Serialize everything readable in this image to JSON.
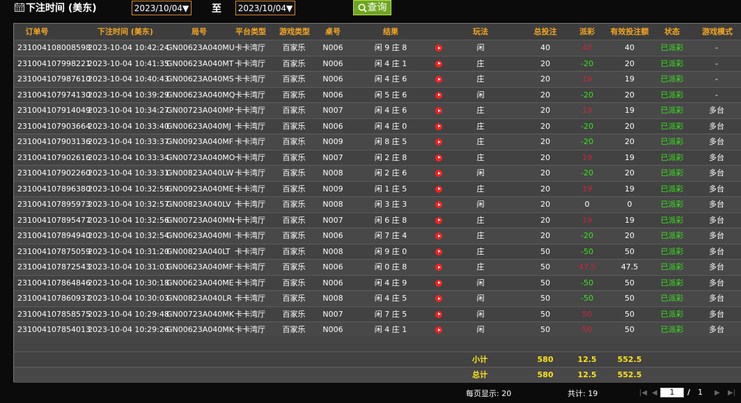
{
  "header": {
    "title": "下注时间 (美东)",
    "start_date": "2023/10/04▼",
    "to_label": "至",
    "end_date": "2023/10/04▼",
    "query_label": "查询"
  },
  "table": {
    "columns": [
      "订单号",
      "下注时间 (美东)",
      "局号",
      "平台类型",
      "游戏类型",
      "桌号",
      "结果",
      "玩法",
      "总投注",
      "派彩",
      "有效投注额",
      "状态",
      "游戏模式"
    ],
    "rows": [
      {
        "order": "231004108008598",
        "time": "2023-10-04 10:42:24",
        "round": "GN00623A040MU",
        "platform": "卡卡湾厅",
        "game": "百家乐",
        "table": "N006",
        "result": "闲 9 庄 8",
        "play": "闲",
        "bet": "40",
        "payout": "40",
        "payout_color": "red",
        "valid": "40",
        "status": "已派彩",
        "mode": "-"
      },
      {
        "order": "231004107998221",
        "time": "2023-10-04 10:41:35",
        "round": "GN00623A040MT",
        "platform": "卡卡湾厅",
        "game": "百家乐",
        "table": "N006",
        "result": "闲 4 庄 1",
        "play": "庄",
        "bet": "20",
        "payout": "-20",
        "payout_color": "green",
        "valid": "20",
        "status": "已派彩",
        "mode": "-"
      },
      {
        "order": "231004107987610",
        "time": "2023-10-04 10:40:43",
        "round": "GN00623A040MS",
        "platform": "卡卡湾厅",
        "game": "百家乐",
        "table": "N006",
        "result": "闲 4 庄 6",
        "play": "庄",
        "bet": "20",
        "payout": "19",
        "payout_color": "red",
        "valid": "19",
        "status": "已派彩",
        "mode": "-"
      },
      {
        "order": "231004107974130",
        "time": "2023-10-04 10:39:29",
        "round": "GN00623A040MQ",
        "platform": "卡卡湾厅",
        "game": "百家乐",
        "table": "N006",
        "result": "闲 5 庄 6",
        "play": "闲",
        "bet": "20",
        "payout": "-20",
        "payout_color": "green",
        "valid": "20",
        "status": "已派彩",
        "mode": "-"
      },
      {
        "order": "231004107914049",
        "time": "2023-10-04 10:34:27",
        "round": "GN00723A040MP",
        "platform": "卡卡湾厅",
        "game": "百家乐",
        "table": "N007",
        "result": "闲 4 庄 6",
        "play": "庄",
        "bet": "20",
        "payout": "19",
        "payout_color": "red",
        "valid": "19",
        "status": "已派彩",
        "mode": "多台"
      },
      {
        "order": "231004107903664",
        "time": "2023-10-04 10:33:40",
        "round": "GN00623A040MJ",
        "platform": "卡卡湾厅",
        "game": "百家乐",
        "table": "N006",
        "result": "闲 4 庄 0",
        "play": "庄",
        "bet": "20",
        "payout": "-20",
        "payout_color": "green",
        "valid": "20",
        "status": "已派彩",
        "mode": "多台"
      },
      {
        "order": "231004107903136",
        "time": "2023-10-04 10:33:37",
        "round": "GN00923A040MF",
        "platform": "卡卡湾厅",
        "game": "百家乐",
        "table": "N009",
        "result": "闲 8 庄 5",
        "play": "庄",
        "bet": "20",
        "payout": "-20",
        "payout_color": "green",
        "valid": "20",
        "status": "已派彩",
        "mode": "多台"
      },
      {
        "order": "231004107902616",
        "time": "2023-10-04 10:33:34",
        "round": "GN00723A040MO",
        "platform": "卡卡湾厅",
        "game": "百家乐",
        "table": "N007",
        "result": "闲 2 庄 8",
        "play": "庄",
        "bet": "20",
        "payout": "19",
        "payout_color": "red",
        "valid": "19",
        "status": "已派彩",
        "mode": "多台"
      },
      {
        "order": "231004107902260",
        "time": "2023-10-04 10:33:31",
        "round": "GN00823A040LW",
        "platform": "卡卡湾厅",
        "game": "百家乐",
        "table": "N008",
        "result": "闲 2 庄 6",
        "play": "闲",
        "bet": "20",
        "payout": "-20",
        "payout_color": "green",
        "valid": "20",
        "status": "已派彩",
        "mode": "多台"
      },
      {
        "order": "231004107896380",
        "time": "2023-10-04 10:32:59",
        "round": "GN00923A040ME",
        "platform": "卡卡湾厅",
        "game": "百家乐",
        "table": "N009",
        "result": "闲 1 庄 5",
        "play": "庄",
        "bet": "20",
        "payout": "19",
        "payout_color": "red",
        "valid": "19",
        "status": "已派彩",
        "mode": "多台"
      },
      {
        "order": "231004107895973",
        "time": "2023-10-04 10:32:57",
        "round": "GN00823A040LV",
        "platform": "卡卡湾厅",
        "game": "百家乐",
        "table": "N008",
        "result": "闲 3 庄 3",
        "play": "闲",
        "bet": "20",
        "payout": "0",
        "payout_color": "white",
        "valid": "0",
        "status": "已派彩",
        "mode": "多台"
      },
      {
        "order": "231004107895477",
        "time": "2023-10-04 10:32:56",
        "round": "GN00723A040MN",
        "platform": "卡卡湾厅",
        "game": "百家乐",
        "table": "N007",
        "result": "闲 6 庄 8",
        "play": "庄",
        "bet": "20",
        "payout": "19",
        "payout_color": "red",
        "valid": "19",
        "status": "已派彩",
        "mode": "多台"
      },
      {
        "order": "231004107894940",
        "time": "2023-10-04 10:32:54",
        "round": "GN00623A040MI",
        "platform": "卡卡湾厅",
        "game": "百家乐",
        "table": "N006",
        "result": "闲 7 庄 4",
        "play": "庄",
        "bet": "20",
        "payout": "-20",
        "payout_color": "green",
        "valid": "20",
        "status": "已派彩",
        "mode": "多台"
      },
      {
        "order": "231004107875059",
        "time": "2023-10-04 10:31:20",
        "round": "GN00823A040LT",
        "platform": "卡卡湾厅",
        "game": "百家乐",
        "table": "N008",
        "result": "闲 9 庄 0",
        "play": "庄",
        "bet": "50",
        "payout": "-50",
        "payout_color": "green",
        "valid": "50",
        "status": "已派彩",
        "mode": "多台"
      },
      {
        "order": "231004107872543",
        "time": "2023-10-04 10:31:03",
        "round": "GN00623A040MF",
        "platform": "卡卡湾厅",
        "game": "百家乐",
        "table": "N006",
        "result": "闲 0 庄 8",
        "play": "庄",
        "bet": "50",
        "payout": "47.5",
        "payout_color": "red",
        "valid": "47.5",
        "status": "已派彩",
        "mode": "多台"
      },
      {
        "order": "231004107864846",
        "time": "2023-10-04 10:30:18",
        "round": "GN00623A040ME",
        "platform": "卡卡湾厅",
        "game": "百家乐",
        "table": "N006",
        "result": "闲 4 庄 9",
        "play": "闲",
        "bet": "50",
        "payout": "-50",
        "payout_color": "green",
        "valid": "50",
        "status": "已派彩",
        "mode": "多台"
      },
      {
        "order": "231004107860937",
        "time": "2023-10-04 10:30:03",
        "round": "GN00823A040LR",
        "platform": "卡卡湾厅",
        "game": "百家乐",
        "table": "N008",
        "result": "闲 4 庄 5",
        "play": "闲",
        "bet": "50",
        "payout": "-50",
        "payout_color": "green",
        "valid": "50",
        "status": "已派彩",
        "mode": "多台"
      },
      {
        "order": "231004107858575",
        "time": "2023-10-04 10:29:48",
        "round": "GN00723A040MK",
        "platform": "卡卡湾厅",
        "game": "百家乐",
        "table": "N007",
        "result": "闲 7 庄 5",
        "play": "闲",
        "bet": "50",
        "payout": "50",
        "payout_color": "red",
        "valid": "50",
        "status": "已派彩",
        "mode": "多台"
      },
      {
        "order": "231004107854013",
        "time": "2023-10-04 10:29:26",
        "round": "GN00623A040MK",
        "platform": "卡卡湾厅",
        "game": "百家乐",
        "table": "N006",
        "result": "闲 4 庄 1",
        "play": "闲",
        "bet": "50",
        "payout": "50",
        "payout_color": "red",
        "valid": "50",
        "status": "已派彩",
        "mode": "多台"
      }
    ],
    "subtotal": {
      "label": "小计",
      "bet": "580",
      "payout": "12.5",
      "valid": "552.5"
    },
    "total": {
      "label": "总计",
      "bet": "580",
      "payout": "12.5",
      "valid": "552.5"
    }
  },
  "footer": {
    "per_page": "每页显示: 20",
    "total_count": "共计: 19",
    "current_page": "1",
    "page_sep": "/",
    "page_count": "1"
  },
  "colors": {
    "header_text": "#f5a623",
    "positive": "#39e61c",
    "negative": "#d0243a",
    "summary": "#ffe31a",
    "query_button": "#6fa621"
  },
  "icons": {
    "calendar": "calendar-icon",
    "search": "search-icon",
    "play": "play-icon",
    "pager": [
      "first-page-icon",
      "prev-page-icon",
      "next-page-icon",
      "last-page-icon"
    ]
  }
}
